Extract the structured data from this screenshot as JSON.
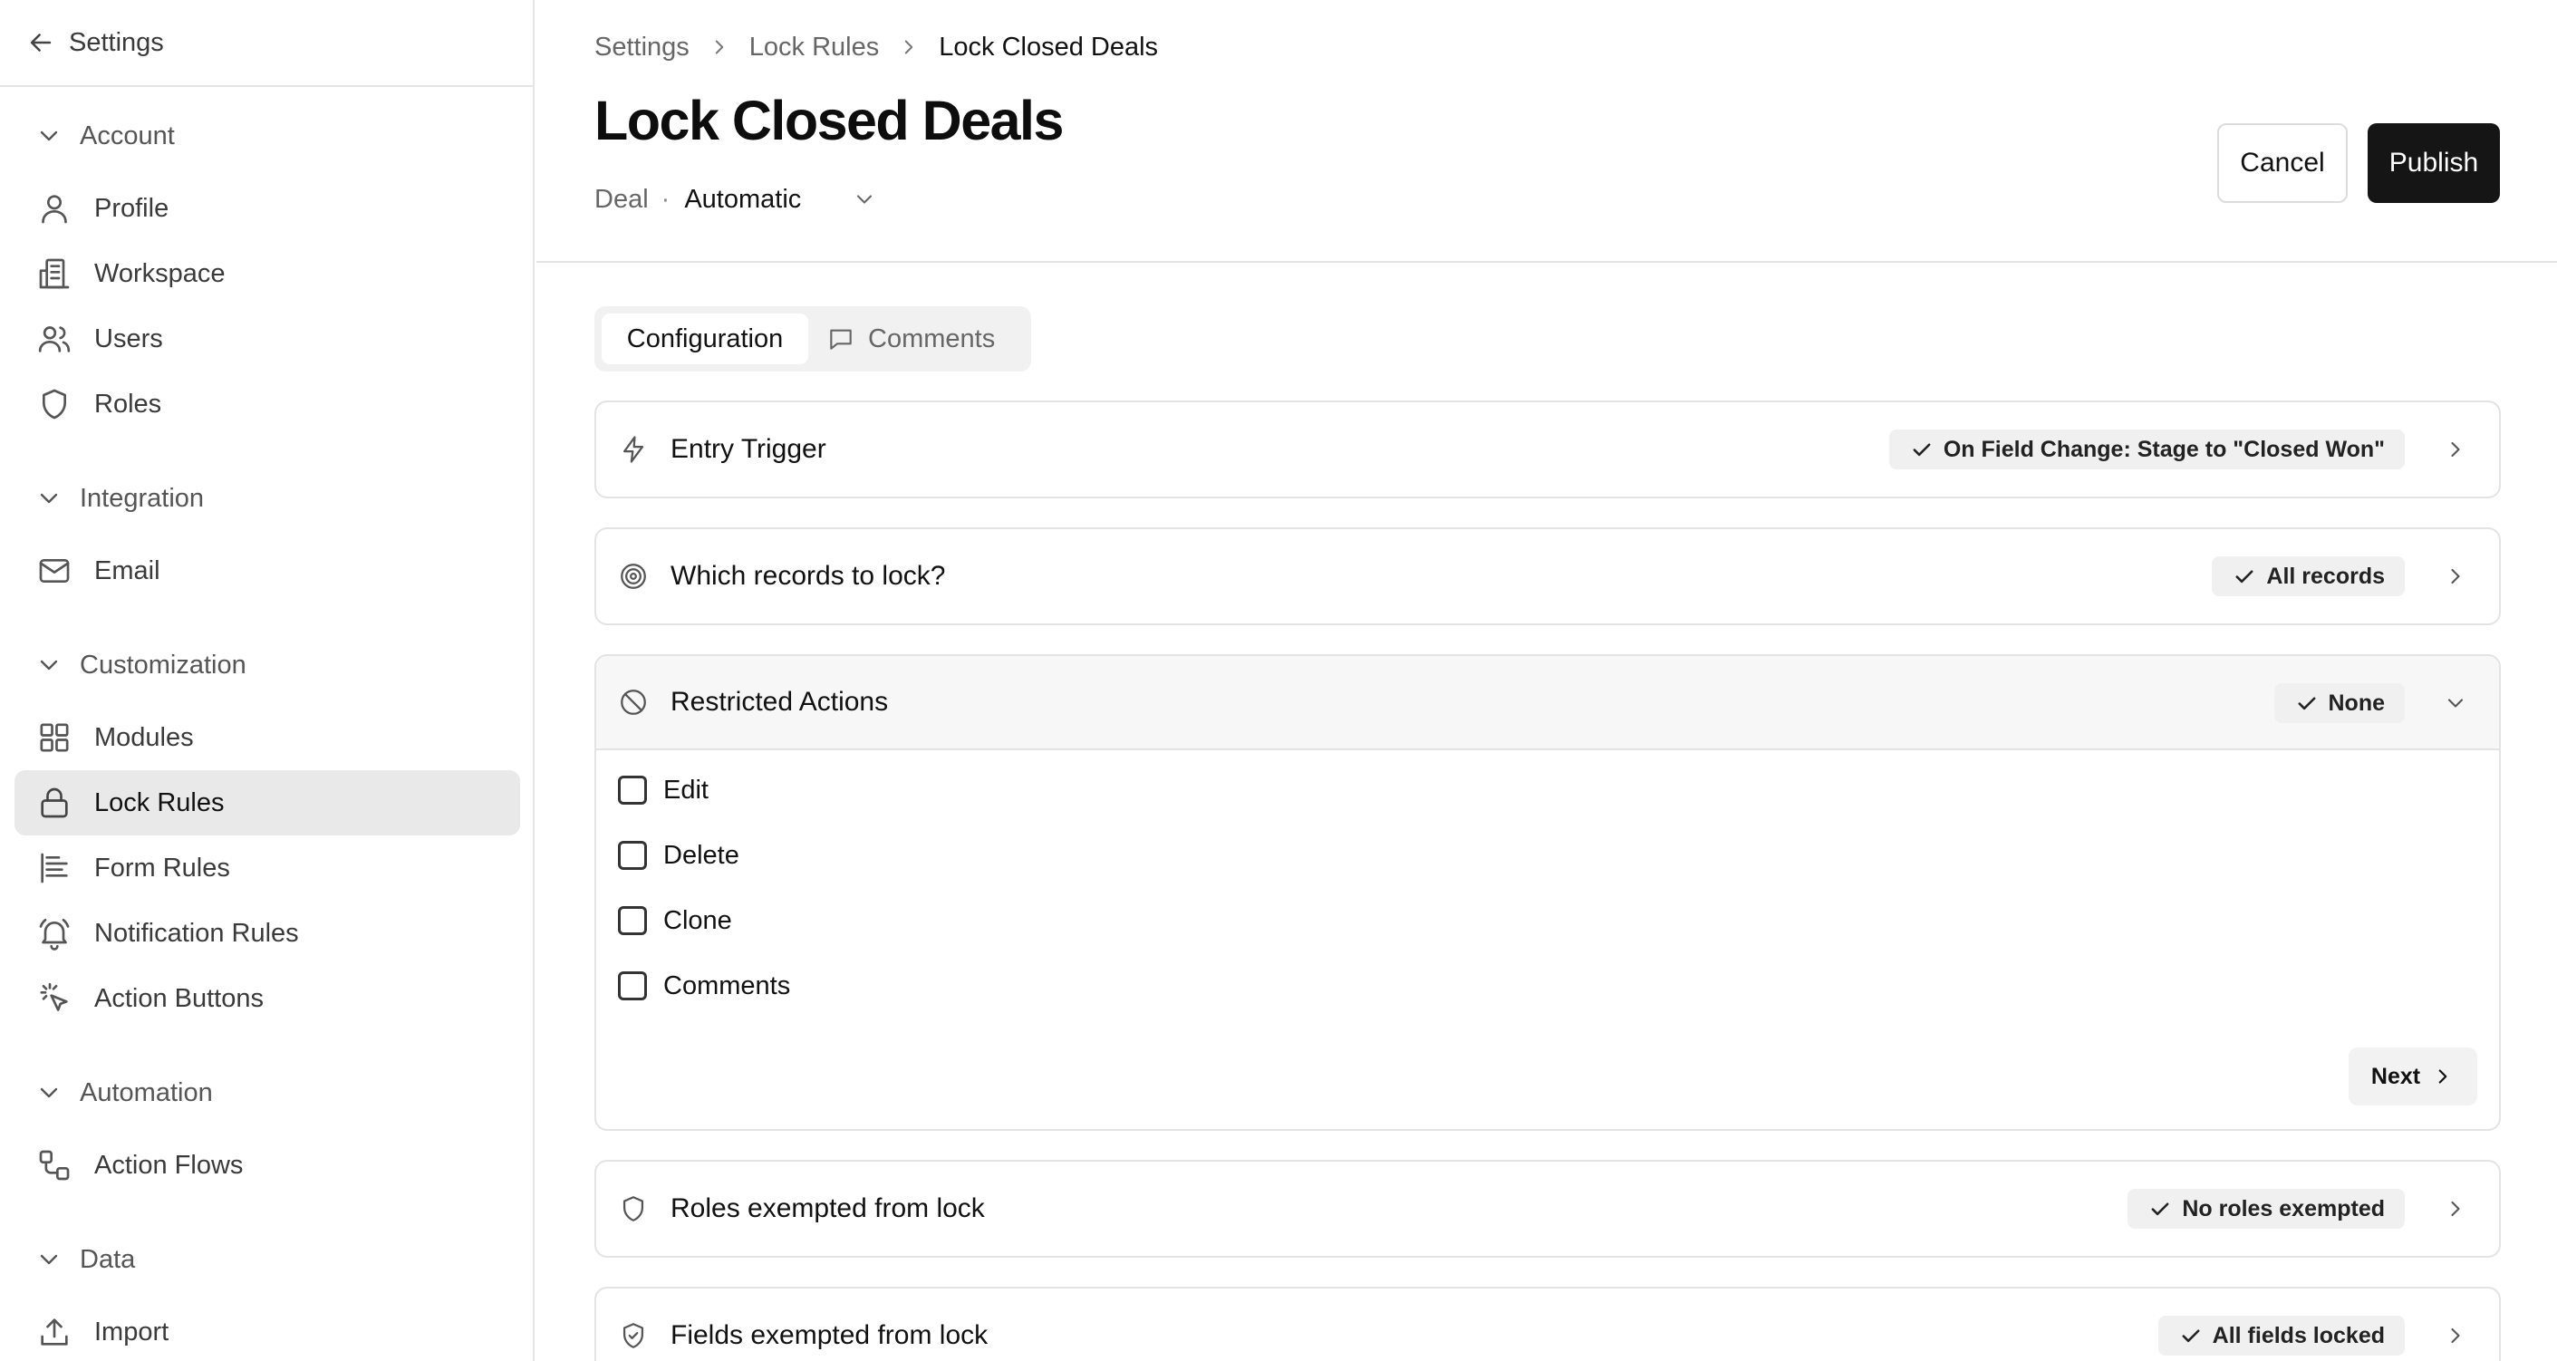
{
  "sidebar": {
    "back_label": "Settings",
    "groups": [
      {
        "label": "Account",
        "items": [
          {
            "label": "Profile",
            "icon": "user-icon"
          },
          {
            "label": "Workspace",
            "icon": "building-icon"
          },
          {
            "label": "Users",
            "icon": "users-icon"
          },
          {
            "label": "Roles",
            "icon": "shield-icon"
          }
        ]
      },
      {
        "label": "Integration",
        "items": [
          {
            "label": "Email",
            "icon": "mail-icon"
          }
        ]
      },
      {
        "label": "Customization",
        "items": [
          {
            "label": "Modules",
            "icon": "grid-icon"
          },
          {
            "label": "Lock Rules",
            "icon": "lock-icon",
            "active": true
          },
          {
            "label": "Form Rules",
            "icon": "form-icon"
          },
          {
            "label": "Notification Rules",
            "icon": "bell-icon"
          },
          {
            "label": "Action Buttons",
            "icon": "pointer-click-icon"
          }
        ]
      },
      {
        "label": "Automation",
        "items": [
          {
            "label": "Action Flows",
            "icon": "workflow-icon"
          }
        ]
      },
      {
        "label": "Data",
        "items": [
          {
            "label": "Import",
            "icon": "upload-icon"
          }
        ]
      }
    ]
  },
  "breadcrumb": [
    "Settings",
    "Lock Rules",
    "Lock Closed Deals"
  ],
  "header": {
    "title": "Lock Closed Deals",
    "module": "Deal",
    "separator": "·",
    "mode": "Automatic",
    "cancel_label": "Cancel",
    "publish_label": "Publish"
  },
  "tabs": [
    {
      "label": "Configuration",
      "active": true
    },
    {
      "label": "Comments",
      "icon": "comment-icon"
    }
  ],
  "sections": [
    {
      "title": "Entry Trigger",
      "icon": "lightning-icon",
      "badge": "On Field Change: Stage to \"Closed Won\""
    },
    {
      "title": "Which records to lock?",
      "icon": "target-icon",
      "badge": "All records"
    },
    {
      "title": "Restricted Actions",
      "icon": "ban-icon",
      "badge": "None",
      "expanded": true,
      "options": [
        "Edit",
        "Delete",
        "Clone",
        "Comments"
      ],
      "next_label": "Next"
    },
    {
      "title": "Roles exempted from lock",
      "icon": "shield-icon",
      "badge": "No roles exempted"
    },
    {
      "title": "Fields exempted from lock",
      "icon": "shield-check-icon",
      "badge": "All fields locked"
    }
  ],
  "colors": {
    "primary_button": "#151515",
    "active_nav_bg": "#e9e9e9",
    "badge_bg": "#f0f0f0",
    "border": "#e3e3e3"
  }
}
